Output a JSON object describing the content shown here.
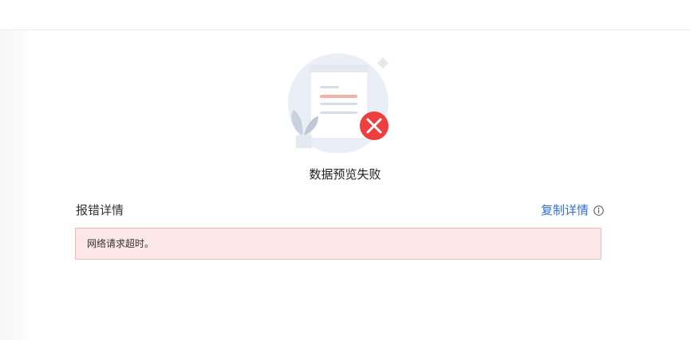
{
  "status": {
    "title": "数据预览失败",
    "icon": "error-x-icon",
    "accent_color": "#ef3e3e"
  },
  "details": {
    "label": "报错详情",
    "copy_label": "复制详情",
    "info_icon": "info-icon",
    "message": "网络请求超时。",
    "box_background": "#fde6e6",
    "box_border": "#f2b9b9",
    "link_color": "#2f6fd6"
  }
}
